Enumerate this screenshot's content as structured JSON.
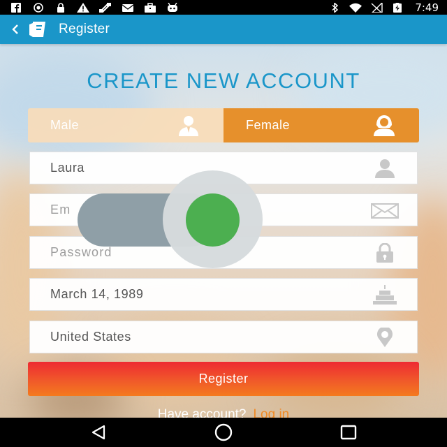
{
  "status_bar": {
    "time": "7:49",
    "left_icons": [
      "facebook-icon",
      "record-icon",
      "lock-icon",
      "warning-icon",
      "fax-icon",
      "mail-icon",
      "briefcase-icon",
      "robot-icon"
    ],
    "right_icons": [
      "bluetooth-icon",
      "wifi-icon",
      "no-signal-icon",
      "battery-charging-icon"
    ]
  },
  "app_bar": {
    "title": "Register",
    "back_icon": "back-chevron-icon",
    "logo_icon": "app-logo-icon",
    "color": "#1a96c9"
  },
  "form": {
    "heading": "CREATE NEW ACCOUNT",
    "gender": {
      "options": [
        {
          "label": "Male",
          "icon": "male-user-icon",
          "selected": false
        },
        {
          "label": "Female",
          "icon": "female-user-icon",
          "selected": true
        }
      ],
      "selected_color": "#e6902c"
    },
    "fields": {
      "name": {
        "value": "Laura",
        "icon": "person-icon"
      },
      "email": {
        "placeholder": "Email",
        "visible_text": "Em",
        "icon": "envelope-icon"
      },
      "password": {
        "placeholder": "Password",
        "icon": "padlock-icon"
      },
      "birthday": {
        "value": "March 14, 1989",
        "icon": "birthday-cake-icon"
      },
      "country": {
        "value": "United States",
        "icon": "location-pin-icon"
      }
    },
    "register_button": "Register",
    "login_prompt": "Have account?",
    "login_link": "Log in"
  },
  "toggle_overlay": {
    "state": "on",
    "thumb_color": "#4caf50",
    "track_color": "#8f9fa7"
  },
  "nav_bar": {
    "buttons": [
      "back-triangle-icon",
      "home-circle-icon",
      "recents-square-icon"
    ]
  }
}
